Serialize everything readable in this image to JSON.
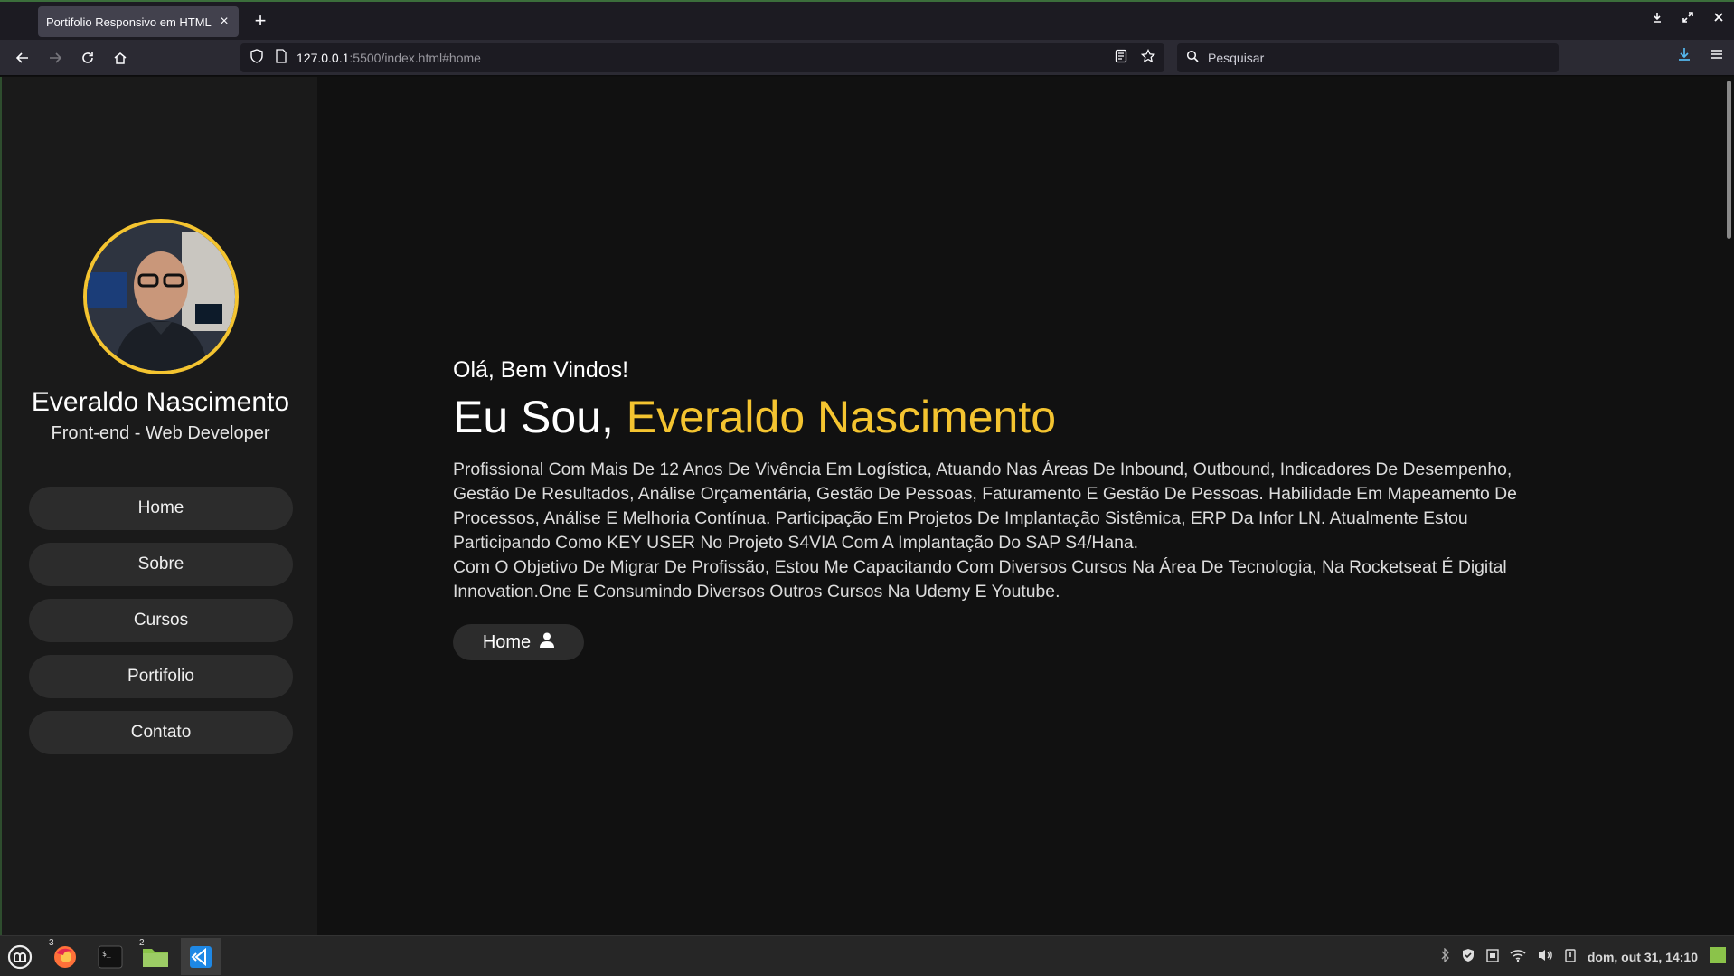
{
  "browser": {
    "tab_title": "Portifolio Responsivo em HTML",
    "url_host": "127.0.0.1",
    "url_path": ":5500/index.html#home",
    "search_placeholder": "Pesquisar"
  },
  "sidebar": {
    "name": "Everaldo Nascimento",
    "role": "Front-end - Web Developer",
    "menu": [
      {
        "label": "Home"
      },
      {
        "label": "Sobre"
      },
      {
        "label": "Cursos"
      },
      {
        "label": "Portifolio"
      },
      {
        "label": "Contato"
      }
    ]
  },
  "hero": {
    "greeting": "Olá, Bem Vindos!",
    "headline_prefix": "Eu Sou, ",
    "headline_name": "Everaldo Nascimento",
    "bio_1": "Profissional Com Mais De 12 Anos De Vivência Em Logística, Atuando Nas Áreas De Inbound, Outbound, Indicadores De Desempenho, Gestão De Resultados, Análise Orçamentária, Gestão De Pessoas, Faturamento E Gestão De Pessoas. Habilidade Em Mapeamento De Processos, Análise E Melhoria Contínua. Participação Em Projetos De Implantação Sistêmica, ERP Da Infor LN. Atualmente Estou Participando Como KEY USER No Projeto S4VIA Com A Implantação Do SAP S4/Hana.",
    "bio_2": "Com O Objetivo De Migrar De Profissão, Estou Me Capacitando Com Diversos Cursos Na Área De Tecnologia, Na Rocketseat É Digital Innovation.One E Consumindo Diversos Outros Cursos Na Udemy E Youtube.",
    "cta_label": "Home"
  },
  "taskbar": {
    "firefox_badge": "3",
    "files_badge": "2",
    "clock": "dom, out 31, 14:10"
  },
  "colors": {
    "accent": "#f4c430",
    "background": "#111111",
    "sidebar": "#1a1a1a",
    "button": "#2c2c2c"
  }
}
